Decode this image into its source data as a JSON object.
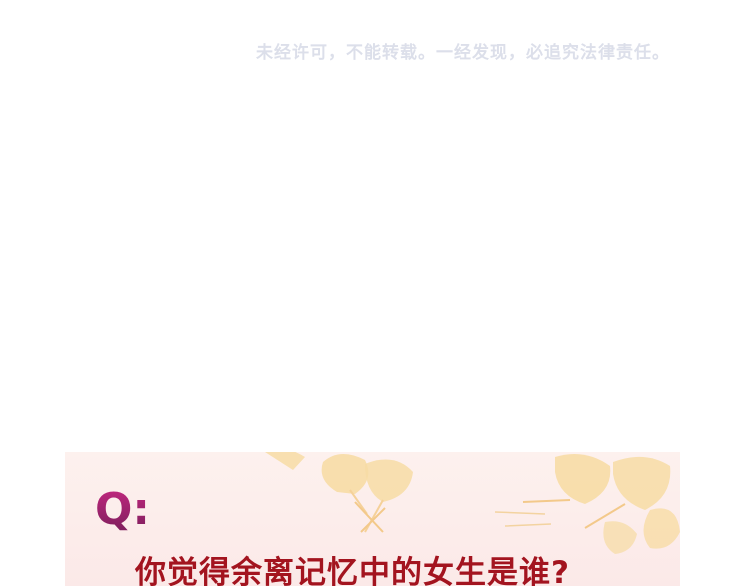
{
  "copyright_notice": "未经许可，不能转载。一经发现，必追究法律责任。",
  "card": {
    "q_marker": "Q:",
    "question": "你觉得余离记忆中的女生是谁?"
  },
  "colors": {
    "notice": "#dcdfea",
    "card_bg": "#fdf1ee",
    "leaf": "#f7dca5",
    "q_top": "#c0277e",
    "q_bottom": "#7e1f5d",
    "question": "#a3141f"
  },
  "icons": [
    "ginkgo-leaf-icon"
  ]
}
